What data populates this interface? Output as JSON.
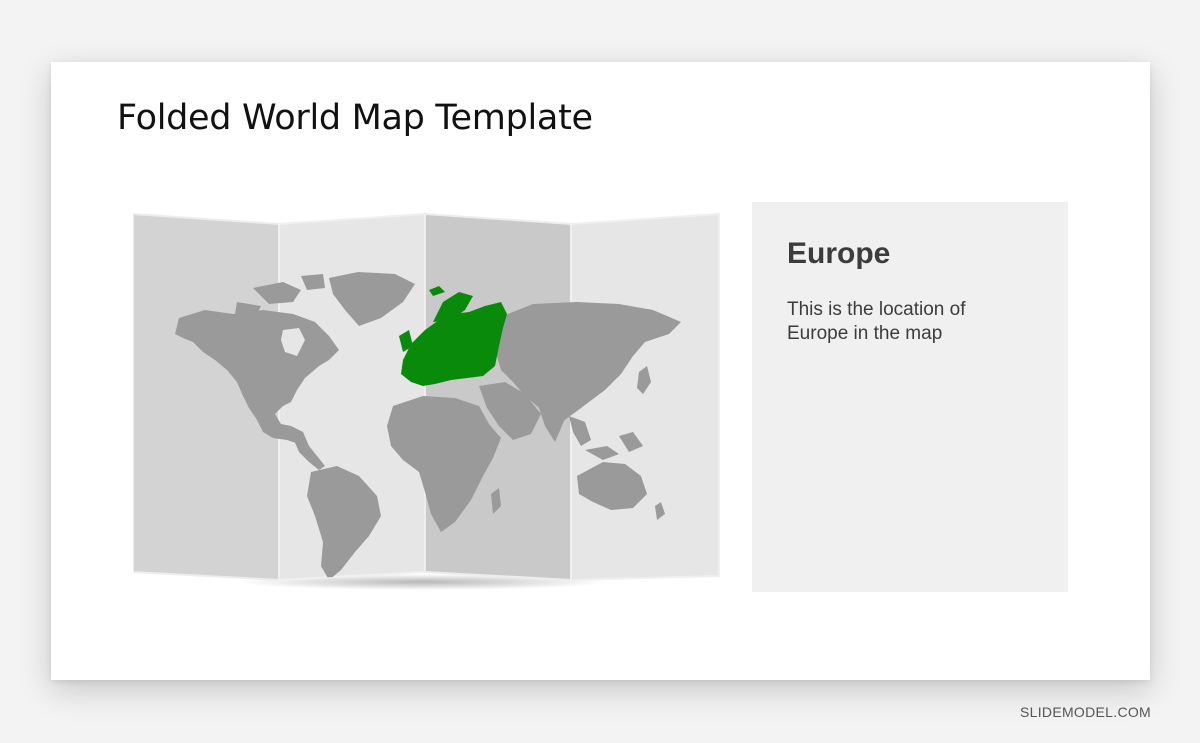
{
  "slide": {
    "title": "Folded World Map Template"
  },
  "map": {
    "highlighted_region": "Europe",
    "highlight_color": "#0a8a0a",
    "land_color": "#9a9a9a",
    "panel_colors": [
      "#d3d3d3",
      "#e6e6e6",
      "#c9c9c9",
      "#e6e6e6"
    ]
  },
  "info": {
    "heading": "Europe",
    "line1": "This is the location of",
    "line2": "Europe in the map"
  },
  "watermark": "SLIDEMODEL.COM"
}
